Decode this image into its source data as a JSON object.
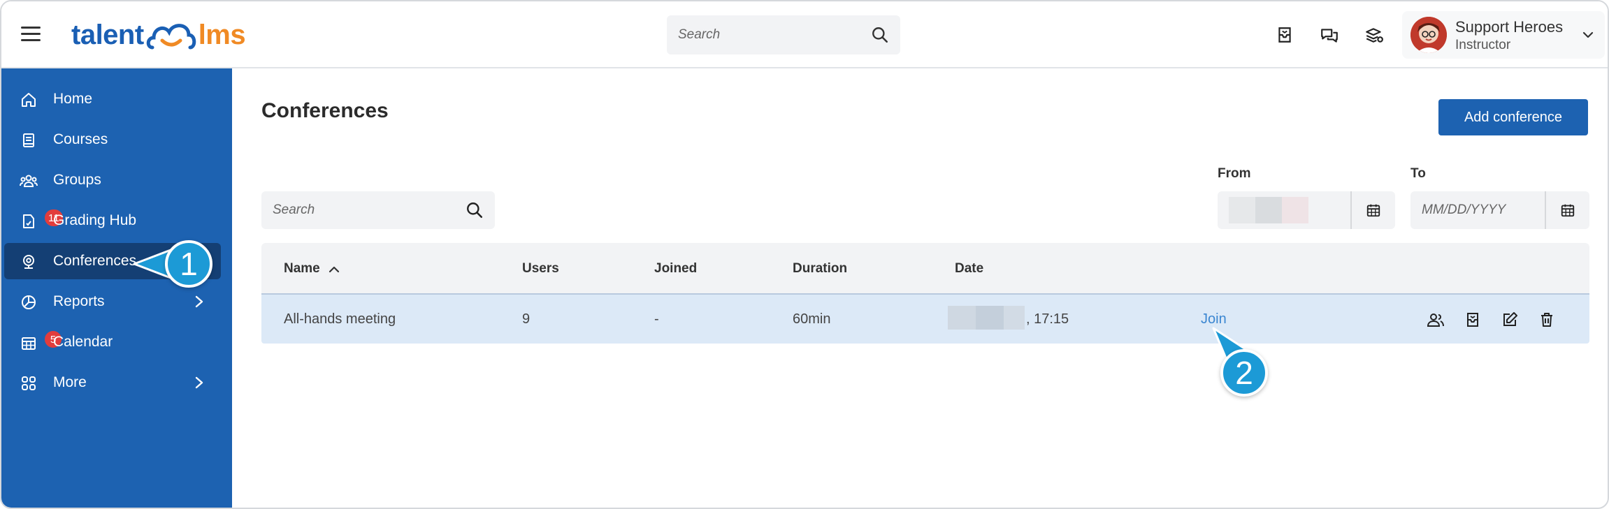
{
  "header": {
    "logo_left": "talent",
    "logo_right": "lms",
    "search_placeholder": "Search",
    "user": {
      "name": "Support Heroes",
      "role": "Instructor"
    }
  },
  "sidebar": {
    "items": [
      {
        "label": "Home",
        "icon": "home-icon"
      },
      {
        "label": "Courses",
        "icon": "courses-icon"
      },
      {
        "label": "Groups",
        "icon": "groups-icon"
      },
      {
        "label": "Grading Hub",
        "icon": "grading-hub-icon",
        "badge": "11"
      },
      {
        "label": "Conferences",
        "icon": "conferences-icon",
        "active": true
      },
      {
        "label": "Reports",
        "icon": "reports-icon",
        "has_submenu": true
      },
      {
        "label": "Calendar",
        "icon": "calendar-icon",
        "badge": "5"
      },
      {
        "label": "More",
        "icon": "more-icon",
        "has_submenu": true
      }
    ]
  },
  "callouts": {
    "first": "1",
    "second": "2"
  },
  "main": {
    "title": "Conferences",
    "add_button": "Add conference",
    "search_placeholder": "Search",
    "from_label": "From",
    "to_label": "To",
    "to_placeholder": "MM/DD/YYYY",
    "table": {
      "columns": [
        "Name",
        "Users",
        "Joined",
        "Duration",
        "Date"
      ],
      "rows": [
        {
          "name": "All-hands meeting",
          "users": "9",
          "joined": "-",
          "duration": "60min",
          "date_time": ", 17:15",
          "action": "Join"
        }
      ]
    }
  },
  "colors": {
    "primary": "#1d62b1",
    "sidebar_active": "#143f74",
    "callout": "#1c9ad6",
    "badge": "#e23c3c",
    "row_highlight": "#dce9f7",
    "logo_orange": "#f08a24"
  }
}
